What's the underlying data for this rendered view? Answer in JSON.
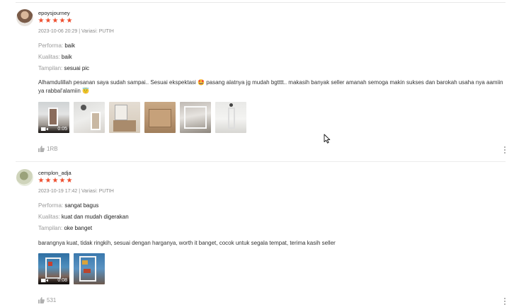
{
  "reviews": [
    {
      "username": "epoysjourney",
      "rating": 5,
      "meta": "2023-10-06 20:29 | Variasi: PUTIH",
      "attributes": [
        {
          "label": "Performa:",
          "value": "baik"
        },
        {
          "label": "Kualitas:",
          "value": "baik"
        },
        {
          "label": "Tampilan:",
          "value": "sesuai pic"
        }
      ],
      "comment": "Alhamdulillah pesanan saya sudah sampai.. Sesuai ekspektasi 🤩 pasang alatnya jg mudah bgtttt.. makasih banyak seller amanah semoga makin sukses dan barokah usaha nya aamiin ya rabbal'alamiin 😇",
      "video_duration": "0:05",
      "likes": "1RB"
    },
    {
      "username": "cemplon_adja",
      "rating": 5,
      "meta": "2023-10-19 17:42 | Variasi: PUTIH",
      "attributes": [
        {
          "label": "Performa:",
          "value": "sangat bagus"
        },
        {
          "label": "Kualitas:",
          "value": "kuat dan mudah digerakan"
        },
        {
          "label": "Tampilan:",
          "value": "oke banget"
        }
      ],
      "comment": "barangnya kuat, tidak ringkih, sesuai dengan harganya, worth it banget, cocok untuk segala tempat, terima kasih seller",
      "video_duration": "0:08",
      "likes": "531"
    }
  ],
  "colors": {
    "star": "#ee4d2d",
    "muted": "#9a9a9a"
  },
  "icons": [
    "star-icon",
    "video-camera-icon",
    "thumbs-up-icon",
    "more-options-icon",
    "mouse-cursor-icon"
  ]
}
